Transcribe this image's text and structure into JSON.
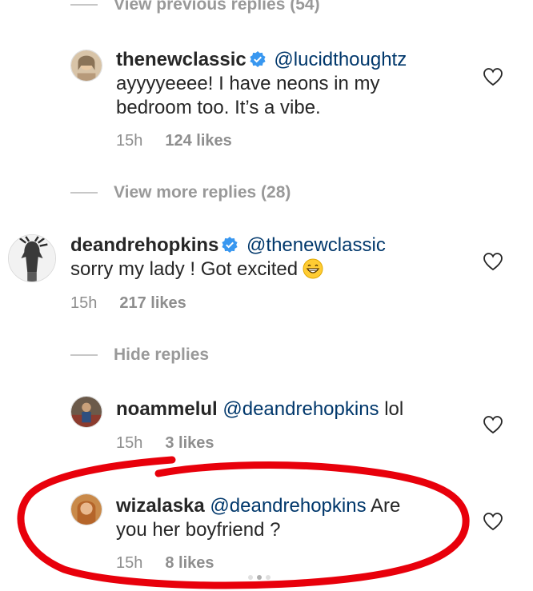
{
  "dividers": {
    "view_previous": "View previous replies (54)",
    "view_more": "View more replies (28)",
    "hide": "Hide replies"
  },
  "comments": [
    {
      "username": "thenewclassic",
      "verified": true,
      "mention": "@lucidthoughtz",
      "line1": "ayyyyeeee! I have neons in my",
      "line2": "bedroom too. It’s a vibe.",
      "time": "15h",
      "likes": "124 likes"
    },
    {
      "username": "deandrehopkins",
      "verified": true,
      "mention": "@thenewclassic",
      "line1": "sorry my lady ! Got excited",
      "emoji": "grinning-face-with-smiling-eyes",
      "time": "15h",
      "likes": "217 likes"
    },
    {
      "username": "noammelul",
      "verified": false,
      "mention": "@deandrehopkins",
      "text_after": "lol",
      "time": "15h",
      "likes": "3 likes"
    },
    {
      "username": "wizalaska",
      "verified": false,
      "mention": "@deandrehopkins",
      "text_after": "Are",
      "line2": "you her boyfriend ?",
      "time": "15h",
      "likes": "8 likes"
    }
  ],
  "icons": {
    "verified": "verified-badge-icon",
    "like": "heart-outline-icon"
  },
  "colors": {
    "mention": "#00376b",
    "muted": "#8e8e8e",
    "verified": "#3897f0",
    "annotation": "#e8000b"
  }
}
